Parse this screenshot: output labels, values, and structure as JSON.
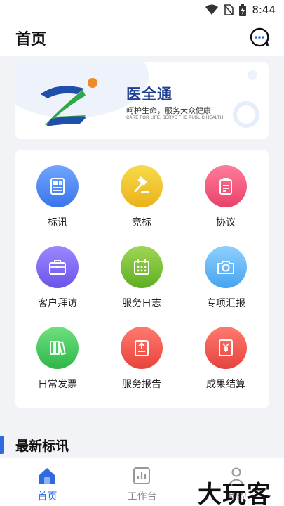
{
  "status_bar": {
    "time": "8:44"
  },
  "header": {
    "title": "首页"
  },
  "banner": {
    "app_name": "医全通",
    "slogan": "呵护生命，服务大众健康",
    "slogan_en": "CARE FOR LIFE, SERVE THE PUBLIC HEALTH"
  },
  "grid": {
    "items": [
      {
        "label": "标讯",
        "icon": "newspaper-icon",
        "color_top": "#6fa6ff",
        "color_bottom": "#3b74ea"
      },
      {
        "label": "竞标",
        "icon": "gavel-icon",
        "color_top": "#f8da4a",
        "color_bottom": "#eab21a"
      },
      {
        "label": "协议",
        "icon": "clipboard-icon",
        "color_top": "#ff7c9a",
        "color_bottom": "#e9426a"
      },
      {
        "label": "客户拜访",
        "icon": "briefcase-icon",
        "color_top": "#9b88ff",
        "color_bottom": "#6b55ea"
      },
      {
        "label": "服务日志",
        "icon": "calendar-icon",
        "color_top": "#9fd654",
        "color_bottom": "#5eae22"
      },
      {
        "label": "专项汇报",
        "icon": "camera-icon",
        "color_top": "#8ed0ff",
        "color_bottom": "#46a4ee"
      },
      {
        "label": "日常发票",
        "icon": "books-icon",
        "color_top": "#6ee07e",
        "color_bottom": "#2fb64a"
      },
      {
        "label": "服务报告",
        "icon": "report-upload-icon",
        "color_top": "#ff7a6e",
        "color_bottom": "#e8433a"
      },
      {
        "label": "成果结算",
        "icon": "yen-document-icon",
        "color_top": "#ff7a6e",
        "color_bottom": "#e5433e"
      }
    ]
  },
  "section": {
    "title": "最新标讯"
  },
  "tabs": [
    {
      "label": "首页",
      "icon": "home-icon",
      "active": true
    },
    {
      "label": "工作台",
      "icon": "chart-icon",
      "active": false
    },
    {
      "label": "我的",
      "icon": "user-icon",
      "active": false
    }
  ],
  "watermark": {
    "text": "大玩客"
  },
  "colors": {
    "accent": "#2d6bdf",
    "brand_text": "#1f3f8f"
  }
}
